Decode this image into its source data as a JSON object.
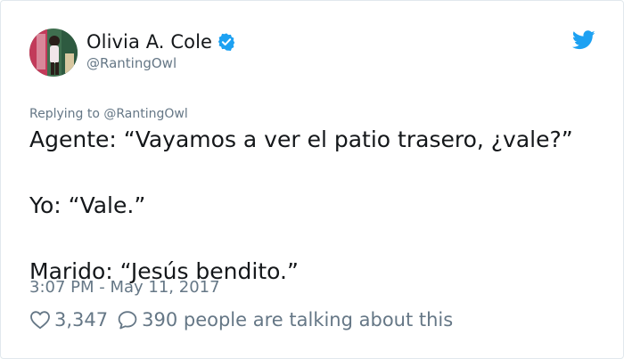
{
  "author": {
    "name": "Olivia A. Cole",
    "handle": "@RantingOwl",
    "verified_icon": "verified-badge-icon",
    "avatar_colors": [
      "#4a7d5a",
      "#c23a5a",
      "#e9c8d2",
      "#2e4a3a"
    ]
  },
  "brand": {
    "icon": "twitter-bird-icon",
    "color": "#1da1f2"
  },
  "reply": {
    "prefix": "Replying to",
    "mention": "@RantingOwl"
  },
  "tweet": {
    "lines": [
      "Agente: “Vayamos a ver el patio trasero, ¿vale?”",
      "Yo: “Vale.”",
      "Marido: “Jesús bendito.”"
    ],
    "timestamp": "3:07 PM - May 11, 2017"
  },
  "actions": {
    "likes": {
      "icon": "heart-icon",
      "count": "3,347"
    },
    "talking": {
      "icon": "speech-bubble-icon",
      "text": "390 people are talking about this"
    }
  }
}
